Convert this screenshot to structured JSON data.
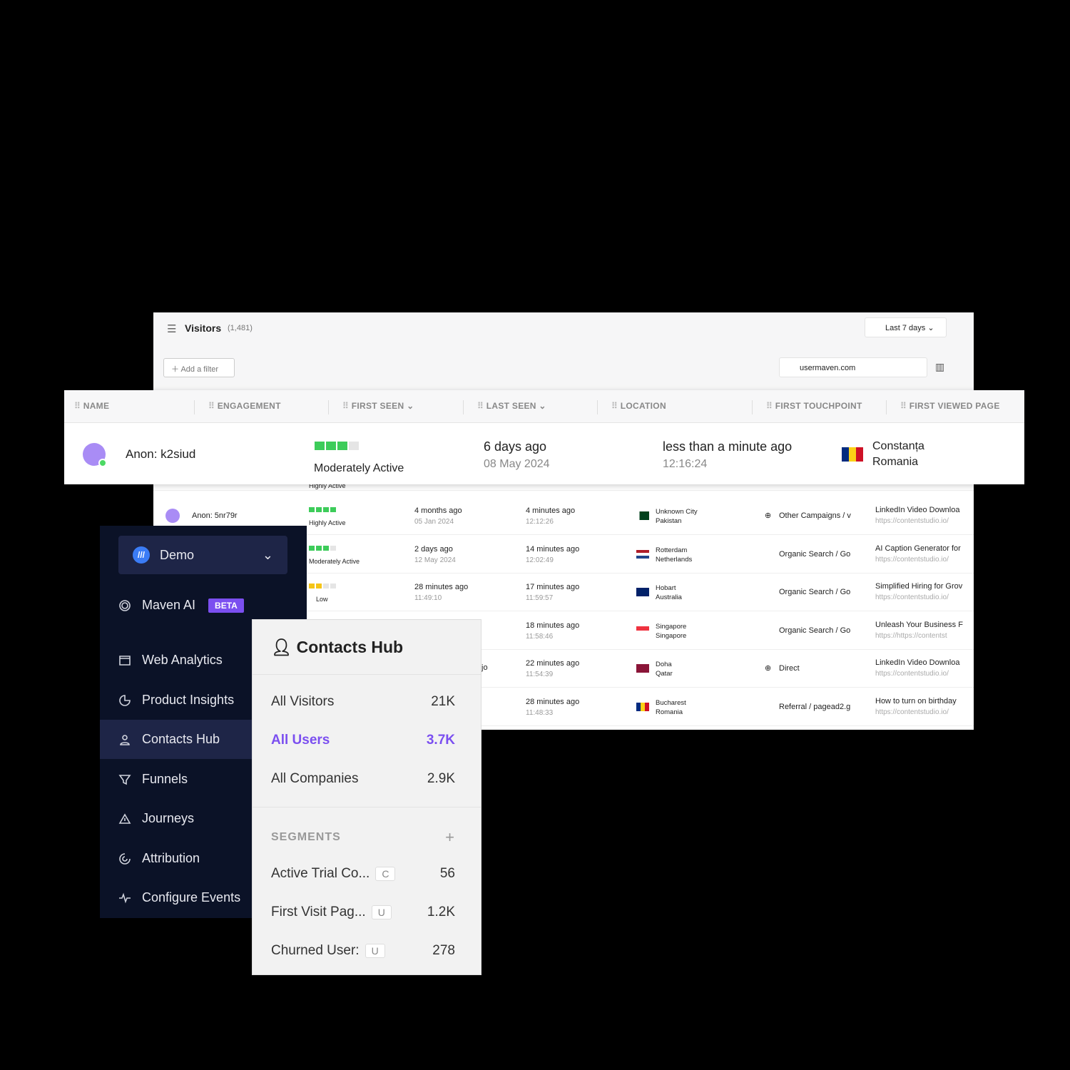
{
  "visitors": {
    "title": "Visitors",
    "count": "(1,481)",
    "date_range": "Last 7 days",
    "add_filter": "Add a filter",
    "domain": "usermaven.com"
  },
  "columns": [
    "NAME",
    "ENGAGEMENT",
    "FIRST SEEN",
    "LAST SEEN",
    "LOCATION",
    "FIRST TOUCHPOINT",
    "FIRST VIEWED PAGE"
  ],
  "highlight": {
    "name": "Anon: k2siud",
    "engagement": "Moderately Active",
    "engagement_level": 3,
    "first_seen": "6 days ago",
    "first_seen_date": "08 May 2024",
    "last_seen": "less than a minute ago",
    "last_seen_time": "12:16:24",
    "city": "Constanța",
    "country": "Romania"
  },
  "partial_row": {
    "engagement": "Highly Active"
  },
  "rows": [
    {
      "name": "Anon: 5nr79r",
      "engagement": "Highly Active",
      "level": 4,
      "color": "#3dcc5a",
      "first_seen": "4 months ago",
      "first_seen_date": "05 Jan 2024",
      "last_seen": "4 minutes ago",
      "last_seen_time": "12:12:26",
      "city": "Unknown City",
      "country": "Pakistan",
      "touchpoint": "Other Campaigns / v",
      "globe": true,
      "page": "LinkedIn Video Downloa",
      "url": "https://contentstudio.io/"
    },
    {
      "engagement": "Moderately Active",
      "level": 3,
      "color": "#3dcc5a",
      "first_seen": "2 days ago",
      "first_seen_date": "12 May 2024",
      "last_seen": "14 minutes ago",
      "last_seen_time": "12:02:49",
      "city": "Rotterdam",
      "country": "Netherlands",
      "touchpoint": "Organic Search / Go",
      "page": "AI Caption Generator for",
      "url": "https://contentstudio.io/"
    },
    {
      "engagement": "Low",
      "level": 2,
      "color": "#f5c518",
      "first_seen": "28 minutes ago",
      "first_seen_date": "11:49:10",
      "last_seen": "17 minutes ago",
      "last_seen_time": "11:59:57",
      "city": "Hobart",
      "country": "Australia",
      "touchpoint": "Organic Search / Go",
      "page": "Simplified Hiring for Grov",
      "url": "https://contentstudio.io/"
    },
    {
      "last_seen": "18 minutes ago",
      "last_seen_time": "11:58:46",
      "city": "Singapore",
      "country": "Singapore",
      "touchpoint": "Organic Search / Go",
      "page": "Unleash Your Business F",
      "url": "https://https://contentst"
    },
    {
      "first_seen_partial": "jo",
      "last_seen": "22 minutes ago",
      "last_seen_time": "11:54:39",
      "city": "Doha",
      "country": "Qatar",
      "touchpoint": "Direct",
      "globe": true,
      "page": "LinkedIn Video Downloa",
      "url": "https://contentstudio.io/"
    },
    {
      "last_seen": "28 minutes ago",
      "last_seen_time": "11:48:33",
      "city": "Bucharest",
      "country": "Romania",
      "touchpoint": "Referral / pagead2.g",
      "page": "How to turn on birthday",
      "url": "https://contentstudio.io/"
    }
  ],
  "sidebar": {
    "workspace": "Demo",
    "items": [
      {
        "label": "Maven AI",
        "badge": "BETA"
      },
      {
        "label": "Web Analytics"
      },
      {
        "label": "Product Insights"
      },
      {
        "label": "Contacts Hub"
      },
      {
        "label": "Funnels"
      },
      {
        "label": "Journeys"
      },
      {
        "label": "Attribution"
      },
      {
        "label": "Configure Events"
      }
    ]
  },
  "hub": {
    "title": "Contacts Hub",
    "items": [
      {
        "label": "All Visitors",
        "count": "21K"
      },
      {
        "label": "All Users",
        "count": "3.7K"
      },
      {
        "label": "All Companies",
        "count": "2.9K"
      }
    ],
    "segments_label": "SEGMENTS",
    "segments": [
      {
        "label": "Active Trial Co...",
        "tag": "C",
        "count": "56"
      },
      {
        "label": "First Visit Pag...",
        "tag": "U",
        "count": "1.2K"
      },
      {
        "label": "Churned User:",
        "tag": "U",
        "count": "278"
      }
    ]
  },
  "colors": {
    "accent": "#7b4ff0",
    "sidebar_bg": "#0b1227",
    "green": "#3dcc5a"
  }
}
